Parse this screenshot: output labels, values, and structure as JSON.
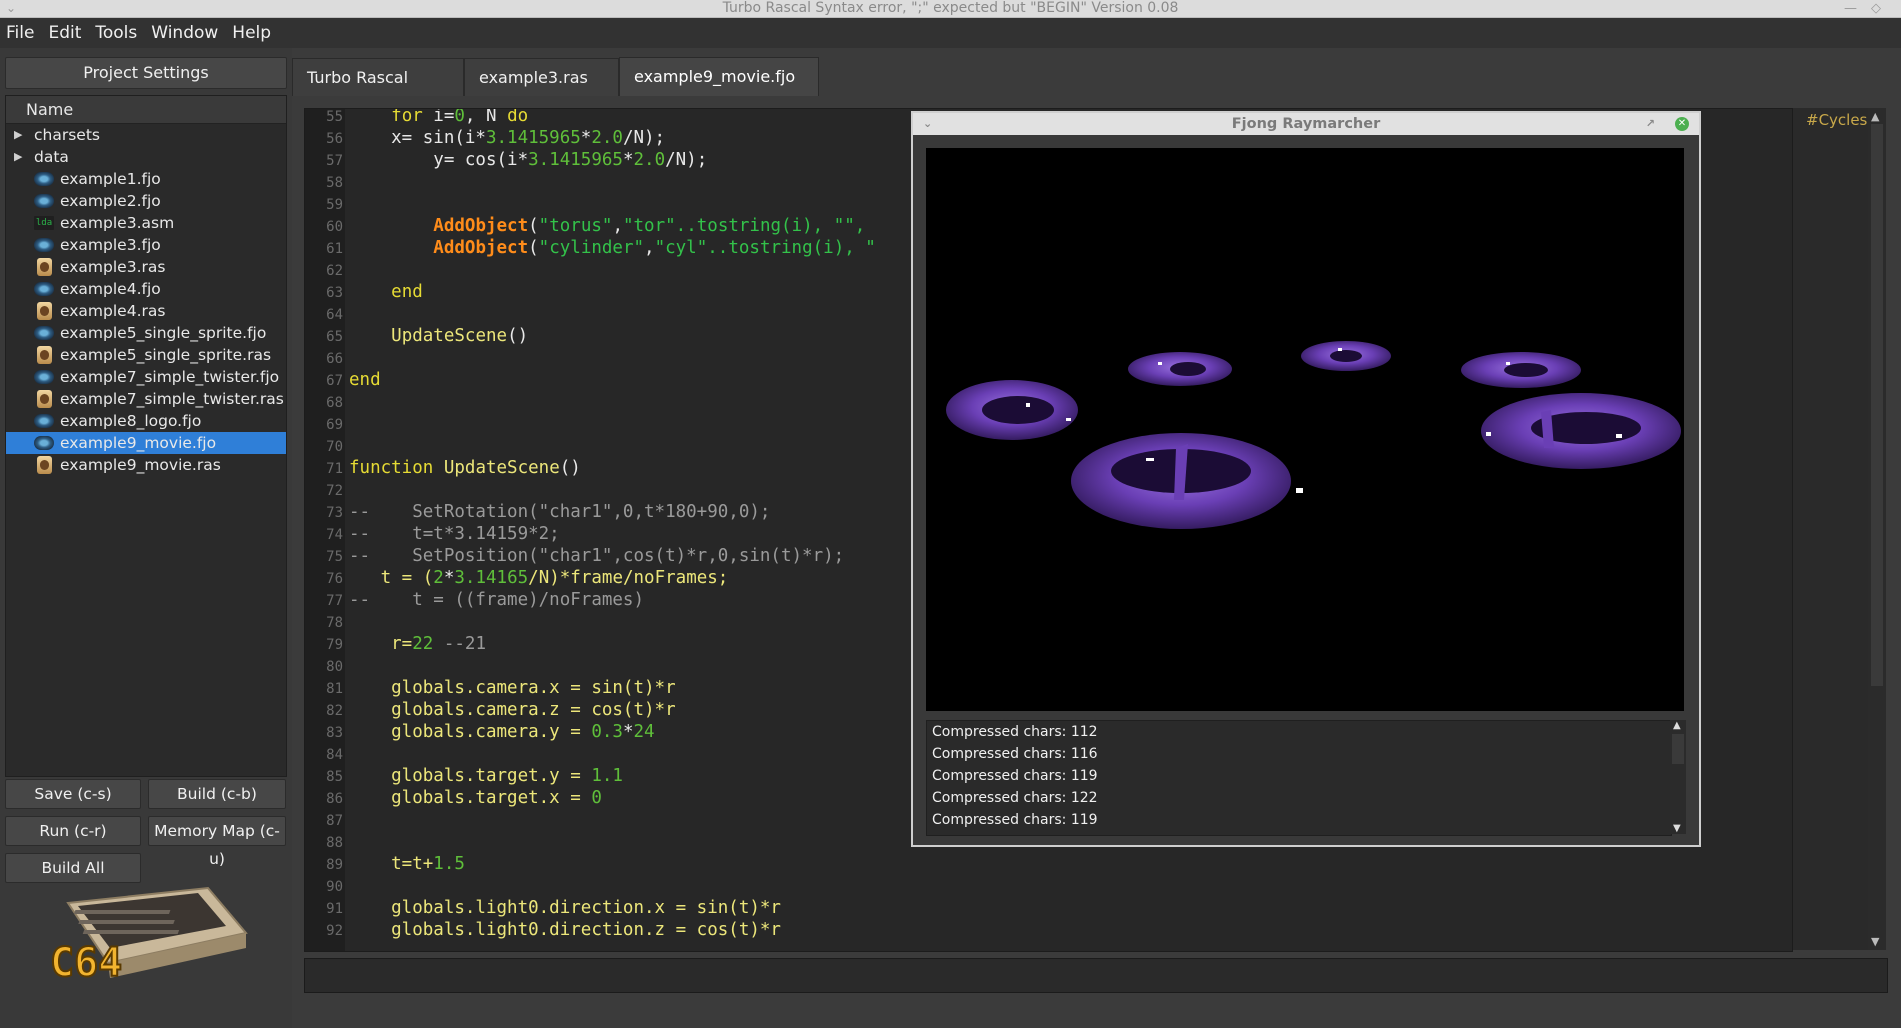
{
  "window": {
    "title": "Turbo Rascal Syntax error, \";\" expected but \"BEGIN\" Version 0.08"
  },
  "menu": [
    "File",
    "Edit",
    "Tools",
    "Window",
    "Help"
  ],
  "left": {
    "project_settings": "Project Settings",
    "tree_header": "Name",
    "folders": [
      "charsets",
      "data"
    ],
    "files": [
      {
        "name": "example1.fjo",
        "icon": "fjo-file-icon"
      },
      {
        "name": "example2.fjo",
        "icon": "fjo-file-icon"
      },
      {
        "name": "example3.asm",
        "icon": "asm-file-icon",
        "badge": "lda"
      },
      {
        "name": "example3.fjo",
        "icon": "fjo-file-icon"
      },
      {
        "name": "example3.ras",
        "icon": "ras-file-icon"
      },
      {
        "name": "example4.fjo",
        "icon": "fjo-file-icon"
      },
      {
        "name": "example4.ras",
        "icon": "ras-file-icon"
      },
      {
        "name": "example5_single_sprite.fjo",
        "icon": "fjo-file-icon"
      },
      {
        "name": "example5_single_sprite.ras",
        "icon": "ras-file-icon"
      },
      {
        "name": "example7_simple_twister.fjo",
        "icon": "fjo-file-icon"
      },
      {
        "name": "example7_simple_twister.ras",
        "icon": "ras-file-icon"
      },
      {
        "name": "example8_logo.fjo",
        "icon": "fjo-file-icon"
      },
      {
        "name": "example9_movie.fjo",
        "icon": "fjo-file-icon",
        "selected": true
      },
      {
        "name": "example9_movie.ras",
        "icon": "ras-file-icon"
      }
    ],
    "buttons": {
      "save": "Save (c-s)",
      "build": "Build (c-b)",
      "run": "Run (c-r)",
      "memory_map": "Memory Map (c-u)",
      "build_all": "Build All"
    },
    "logo_text": "C64"
  },
  "tabs": [
    "Turbo Rascal Solution",
    "example3.ras",
    "example9_movie.fjo"
  ],
  "active_tab": 2,
  "cycles_label": "#Cycles",
  "dialog": {
    "title": "Fjong Raymarcher",
    "log": [
      "Compressed chars: 112",
      "Compressed chars: 116",
      "Compressed chars: 119",
      "Compressed chars: 122",
      "Compressed chars: 119"
    ]
  },
  "colors": {
    "selection": "#2f7fd8",
    "keyword": "#e6db34",
    "number": "#5fbf3a",
    "string": "#33c24a",
    "object_call": "#ff8c1a",
    "comment": "#9a9a9a",
    "render_purple": "#6a3fb5"
  },
  "code_lines": [
    {
      "n": "55",
      "t": [
        [
          "    ",
          "fn"
        ],
        [
          "for",
          "kw"
        ],
        [
          " i=",
          "fn"
        ],
        [
          "0",
          "num2"
        ],
        [
          ", N ",
          "fn"
        ],
        [
          "do",
          "kw"
        ]
      ]
    },
    {
      "n": "56",
      "t": [
        [
          "    x= sin(i*",
          "fn"
        ],
        [
          "3.1415965",
          "num2"
        ],
        [
          "*",
          "fn"
        ],
        [
          "2.0",
          "num2"
        ],
        [
          "/N);",
          "fn"
        ]
      ]
    },
    {
      "n": "57",
      "t": [
        [
          "        y= cos(i*",
          "fn"
        ],
        [
          "3.1415965",
          "num2"
        ],
        [
          "*",
          "fn"
        ],
        [
          "2.0",
          "num2"
        ],
        [
          "/N);",
          "fn"
        ]
      ]
    },
    {
      "n": "58",
      "t": []
    },
    {
      "n": "59",
      "t": []
    },
    {
      "n": "60",
      "t": [
        [
          "        ",
          "fn"
        ],
        [
          "AddObject",
          "obj"
        ],
        [
          "(",
          "fn"
        ],
        [
          "\"torus\"",
          "str"
        ],
        [
          ",",
          "fn"
        ],
        [
          "\"tor\"",
          "str"
        ],
        [
          "..tostring(i), ",
          "str"
        ],
        [
          "\"\",",
          "str"
        ]
      ]
    },
    {
      "n": "61",
      "t": [
        [
          "        ",
          "fn"
        ],
        [
          "AddObject",
          "obj"
        ],
        [
          "(",
          "fn"
        ],
        [
          "\"cylinder\"",
          "str"
        ],
        [
          ",",
          "fn"
        ],
        [
          "\"cyl\"",
          "str"
        ],
        [
          "..tostring(i), \"",
          "str"
        ]
      ]
    },
    {
      "n": "62",
      "t": []
    },
    {
      "n": "63",
      "t": [
        [
          "    ",
          "fn"
        ],
        [
          "end",
          "kw"
        ]
      ]
    },
    {
      "n": "64",
      "t": []
    },
    {
      "n": "65",
      "t": [
        [
          "    ",
          "fn"
        ],
        [
          "UpdateScene",
          "def"
        ],
        [
          "()",
          "fn"
        ]
      ]
    },
    {
      "n": "66",
      "t": []
    },
    {
      "n": "67",
      "t": [
        [
          "end",
          "kw"
        ]
      ]
    },
    {
      "n": "68",
      "t": []
    },
    {
      "n": "69",
      "t": []
    },
    {
      "n": "70",
      "t": []
    },
    {
      "n": "71",
      "t": [
        [
          "function",
          "kw"
        ],
        [
          " ",
          "fn"
        ],
        [
          "UpdateScene",
          "def"
        ],
        [
          "()",
          "fn"
        ]
      ]
    },
    {
      "n": "72",
      "t": []
    },
    {
      "n": "73",
      "t": [
        [
          "--    SetRotation(\"char1\",0,t*180+90,0);",
          "cmt"
        ]
      ]
    },
    {
      "n": "74",
      "t": [
        [
          "--    t=t*3.14159*2;",
          "cmt"
        ]
      ]
    },
    {
      "n": "75",
      "t": [
        [
          "--    SetPosition(\"char1\",cos(t)*r,0,sin(t)*r);",
          "cmt"
        ]
      ]
    },
    {
      "n": "76",
      "t": [
        [
          "   t = (",
          "def"
        ],
        [
          "2",
          "num2"
        ],
        [
          "*",
          "fn"
        ],
        [
          "3.14165",
          "num2"
        ],
        [
          "/N)*frame/noFrames;",
          "def"
        ]
      ]
    },
    {
      "n": "77",
      "t": [
        [
          "--    t = ((frame)/noFrames)",
          "cmt"
        ]
      ]
    },
    {
      "n": "78",
      "t": []
    },
    {
      "n": "79",
      "t": [
        [
          "    r=",
          "def"
        ],
        [
          "22",
          "num2"
        ],
        [
          " --21",
          "cmt"
        ]
      ]
    },
    {
      "n": "80",
      "t": []
    },
    {
      "n": "81",
      "t": [
        [
          "    globals.camera.x = sin(t)*r",
          "def"
        ]
      ]
    },
    {
      "n": "82",
      "t": [
        [
          "    globals.camera.z = cos(t)*r",
          "def"
        ]
      ]
    },
    {
      "n": "83",
      "t": [
        [
          "    globals.camera.y = ",
          "def"
        ],
        [
          "0.3",
          "num2"
        ],
        [
          "*",
          "fn"
        ],
        [
          "24",
          "num2"
        ]
      ]
    },
    {
      "n": "84",
      "t": []
    },
    {
      "n": "85",
      "t": [
        [
          "    globals.target.y = ",
          "def"
        ],
        [
          "1.1",
          "num2"
        ]
      ]
    },
    {
      "n": "86",
      "t": [
        [
          "    globals.target.x = ",
          "def"
        ],
        [
          "0",
          "num2"
        ]
      ]
    },
    {
      "n": "87",
      "t": []
    },
    {
      "n": "88",
      "t": []
    },
    {
      "n": "89",
      "t": [
        [
          "    t=t+",
          "def"
        ],
        [
          "1.5",
          "num2"
        ]
      ]
    },
    {
      "n": "90",
      "t": []
    },
    {
      "n": "91",
      "t": [
        [
          "    globals.light0.direction.x = sin(t)*r",
          "def"
        ]
      ]
    },
    {
      "n": "92",
      "t": [
        [
          "    globals.light0.direction.z = cos(t)*r",
          "def"
        ]
      ]
    }
  ]
}
